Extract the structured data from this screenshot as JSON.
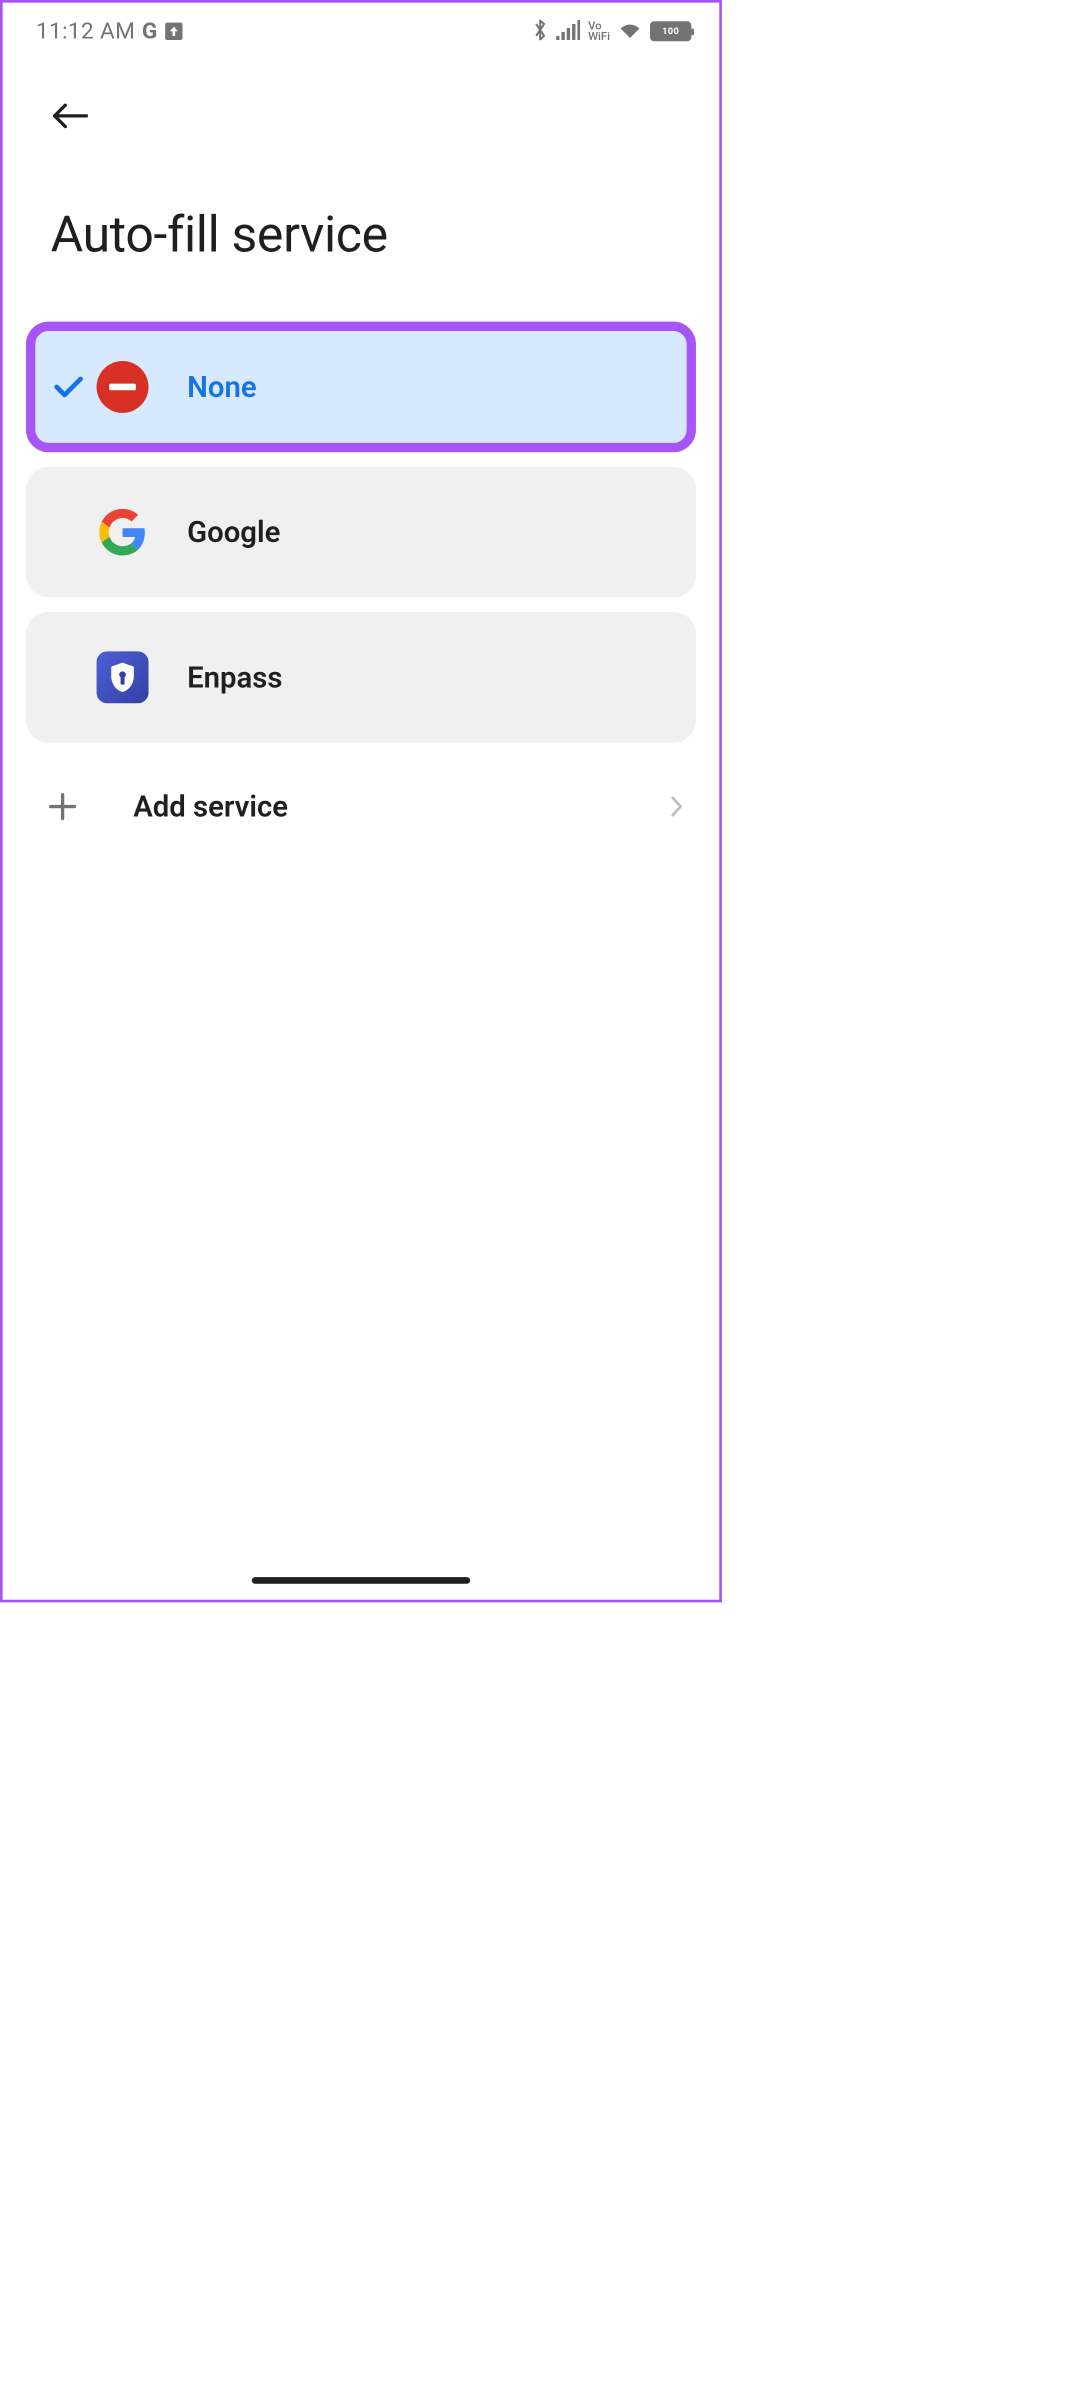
{
  "status_bar": {
    "time": "11:12 AM",
    "g_indicator": "G",
    "battery_text": "100",
    "vowifi": "Vo\nWiFi"
  },
  "page_title": "Auto-fill service",
  "options": [
    {
      "id": "none",
      "label": "None",
      "selected": true,
      "highlighted": true,
      "icon": "none-icon"
    },
    {
      "id": "google",
      "label": "Google",
      "selected": false,
      "highlighted": false,
      "icon": "google-icon"
    },
    {
      "id": "enpass",
      "label": "Enpass",
      "selected": false,
      "highlighted": false,
      "icon": "enpass-icon"
    }
  ],
  "add_service_label": "Add service",
  "colors": {
    "accent_highlight": "#a855f7",
    "selected_bg": "#d6e9ff",
    "selected_text": "#1473e6",
    "option_bg": "#f0f0f0",
    "none_red": "#d93025",
    "text": "#1f1f1f",
    "muted": "#737373"
  }
}
